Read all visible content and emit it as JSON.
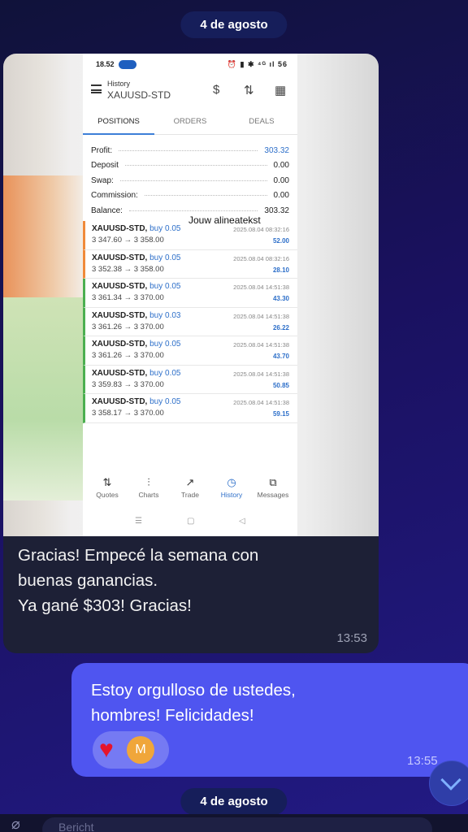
{
  "dates": {
    "top": "4 de agosto",
    "bottom": "4 de agosto"
  },
  "incoming": {
    "screenshot": {
      "status_time": "18.52",
      "status_icons": "⏰ ▮ ✱ ⁴ᴳ ıl 56",
      "header": {
        "subtitle": "History",
        "title": "XAUUSD-STD"
      },
      "tabs": [
        "POSITIONS",
        "ORDERS",
        "DEALS"
      ],
      "summary": [
        {
          "label": "Profit:",
          "value": "303.32"
        },
        {
          "label": "Deposit",
          "value": "0.00"
        },
        {
          "label": "Swap:",
          "value": "0.00"
        },
        {
          "label": "Commission:",
          "value": "0.00"
        },
        {
          "label": "Balance:",
          "value": "303.32"
        }
      ],
      "overlay_text": "Jouw alineatekst",
      "trades": [
        {
          "symbol": "XAUUSD-STD,",
          "side": "buy 0.05",
          "prices": "3 347.60 → 3 358.00",
          "time": "2025.08.04 08:32:16",
          "profit": "52.00"
        },
        {
          "symbol": "XAUUSD-STD,",
          "side": "buy 0.05",
          "prices": "3 352.38 → 3 358.00",
          "time": "2025.08.04 08:32:16",
          "profit": "28.10"
        },
        {
          "symbol": "XAUUSD-STD,",
          "side": "buy 0.05",
          "prices": "3 361.34 → 3 370.00",
          "time": "2025.08.04 14:51:38",
          "profit": "43.30"
        },
        {
          "symbol": "XAUUSD-STD,",
          "side": "buy 0.03",
          "prices": "3 361.26 → 3 370.00",
          "time": "2025.08.04 14:51:38",
          "profit": "26.22"
        },
        {
          "symbol": "XAUUSD-STD,",
          "side": "buy 0.05",
          "prices": "3 361.26 → 3 370.00",
          "time": "2025.08.04 14:51:38",
          "profit": "43.70"
        },
        {
          "symbol": "XAUUSD-STD,",
          "side": "buy 0.05",
          "prices": "3 359.83 → 3 370.00",
          "time": "2025.08.04 14:51:38",
          "profit": "50.85"
        },
        {
          "symbol": "XAUUSD-STD,",
          "side": "buy 0.05",
          "prices": "3 358.17 → 3 370.00",
          "time": "2025.08.04 14:51:38",
          "profit": "59.15"
        }
      ],
      "bottom_nav": [
        "Quotes",
        "Charts",
        "Trade",
        "History",
        "Messages"
      ]
    },
    "text_lines": [
      "Gracias! Empecé la semana con",
      "buenas ganancias.",
      "Ya gané $303! Gracias!"
    ],
    "time": "13:53"
  },
  "outgoing": {
    "text_lines": [
      "Estoy orgulloso de ustedes,",
      "hombres! Felicidades!"
    ],
    "reactions": {
      "avatar_letter": "M"
    },
    "time": "13:55"
  },
  "input": {
    "placeholder": "Bericht"
  },
  "colors": {
    "accent": "#4f55f0",
    "profit_blue": "#2d6fc9",
    "heart": "#e5142c"
  }
}
